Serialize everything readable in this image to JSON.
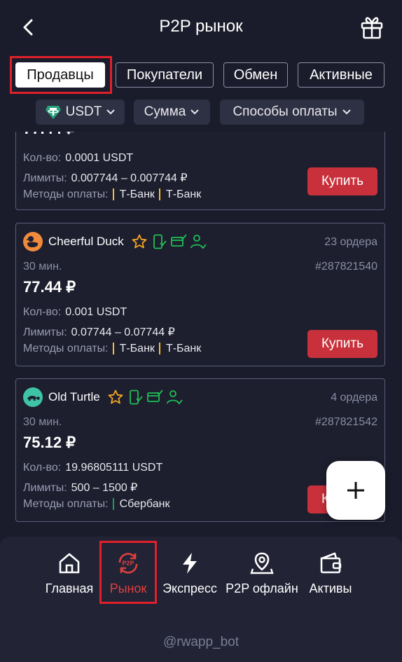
{
  "header": {
    "title": "P2P рынок"
  },
  "tabs": [
    {
      "label": "Продавцы"
    },
    {
      "label": "Покупатели"
    },
    {
      "label": "Обмен"
    },
    {
      "label": "Активные"
    }
  ],
  "filters": {
    "currency": "USDT",
    "amount": "Сумма",
    "payment": "Способы оплаты"
  },
  "labels": {
    "qty": "Кол-во:",
    "limits": "Лимиты:",
    "methods": "Методы оплаты:",
    "buy": "Купить"
  },
  "offers": [
    {
      "qty": "0.0001 USDT",
      "limits": "0.007744 – 0.007744 ₽",
      "methods": [
        "Т-Банк",
        "Т-Банк"
      ]
    },
    {
      "seller": "Cheerful Duck",
      "orders": "23 ордера",
      "time": "30 мин.",
      "order_id": "#287821540",
      "price": "77.44 ₽",
      "qty": "0.001 USDT",
      "limits": "0.07744 – 0.07744 ₽",
      "methods": [
        "Т-Банк",
        "Т-Банк"
      ]
    },
    {
      "seller": "Old Turtle",
      "orders": "4 ордера",
      "time": "30 мин.",
      "order_id": "#287821542",
      "price": "75.12 ₽",
      "qty": "19.96805111 USDT",
      "limits": "500 – 1500 ₽",
      "methods": [
        "Сбербанк"
      ]
    }
  ],
  "nav": {
    "items": [
      {
        "label": "Главная"
      },
      {
        "label": "Рынок"
      },
      {
        "label": "Экспресс"
      },
      {
        "label": "P2P офлайн"
      },
      {
        "label": "Активы"
      }
    ],
    "p2p_badge": "P2P"
  },
  "footer": {
    "bot": "@rwapp_bot"
  },
  "colors": {
    "accent": "#e0403f",
    "buy": "#c8313b",
    "badge_green": "#1fbf55",
    "star": "#f5a623"
  }
}
